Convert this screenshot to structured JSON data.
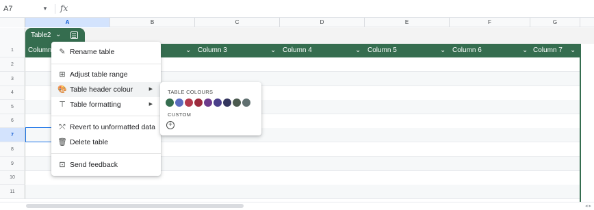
{
  "formula_bar": {
    "cell_ref": "A7",
    "fx": "fx"
  },
  "columns": [
    "A",
    "B",
    "C",
    "D",
    "E",
    "F",
    "G"
  ],
  "rows": [
    "1",
    "2",
    "3",
    "4",
    "5",
    "6",
    "7",
    "8",
    "9",
    "10",
    "11"
  ],
  "table": {
    "name": "Table2",
    "header_color": "#356d4f",
    "headers": [
      "Column",
      "Column 3",
      "Column 4",
      "Column 5",
      "Column 6",
      "Column 7"
    ]
  },
  "menu": {
    "items": [
      {
        "label": "Rename table",
        "icon": "rename-icon"
      },
      {
        "label": "Adjust table range",
        "icon": "table-range-icon"
      },
      {
        "label": "Table header colour",
        "icon": "palette-icon"
      },
      {
        "label": "Table formatting",
        "icon": "paint-roller-icon"
      },
      {
        "label": "Revert to unformatted data",
        "icon": "revert-icon"
      },
      {
        "label": "Delete table",
        "icon": "trash-icon"
      },
      {
        "label": "Send feedback",
        "icon": "feedback-icon"
      }
    ]
  },
  "submenu": {
    "title": "TABLE COLOURS",
    "custom_label": "CUSTOM",
    "swatches": [
      "#356d4f",
      "#5b6bbf",
      "#b3394d",
      "#9c2b3d",
      "#6d3b8c",
      "#4a3f8a",
      "#33355e",
      "#4b5a4f",
      "#607070"
    ]
  }
}
